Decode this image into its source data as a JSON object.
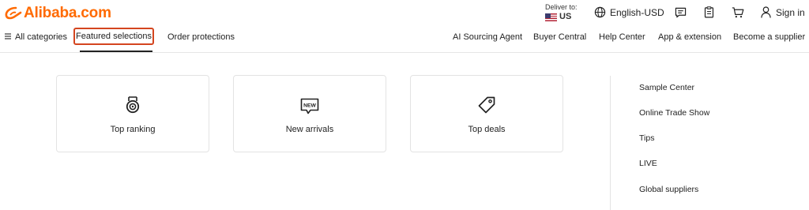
{
  "brand": {
    "name": "Alibaba.com",
    "color": "#ff6a00"
  },
  "header": {
    "deliver_label": "Deliver to:",
    "country": "US",
    "language": "English-USD",
    "signin": "Sign in",
    "icons": [
      "globe-icon",
      "message-icon",
      "orders-icon",
      "cart-icon",
      "user-icon"
    ]
  },
  "nav": {
    "all_categories": "All categories",
    "featured": "Featured selections",
    "order_protections": "Order protections",
    "right": [
      "AI Sourcing Agent",
      "Buyer Central",
      "Help Center",
      "App & extension",
      "Become a supplier"
    ]
  },
  "cards": [
    {
      "label": "Top ranking",
      "icon": "medal-icon"
    },
    {
      "label": "New arrivals",
      "icon": "new-badge-icon"
    },
    {
      "label": "Top deals",
      "icon": "tag-icon"
    }
  ],
  "new_badge_text": "NEW",
  "sidebar": [
    "Sample Center",
    "Online Trade Show",
    "Tips",
    "LIVE",
    "Global suppliers"
  ],
  "colors": {
    "highlight": "#d4451f"
  }
}
